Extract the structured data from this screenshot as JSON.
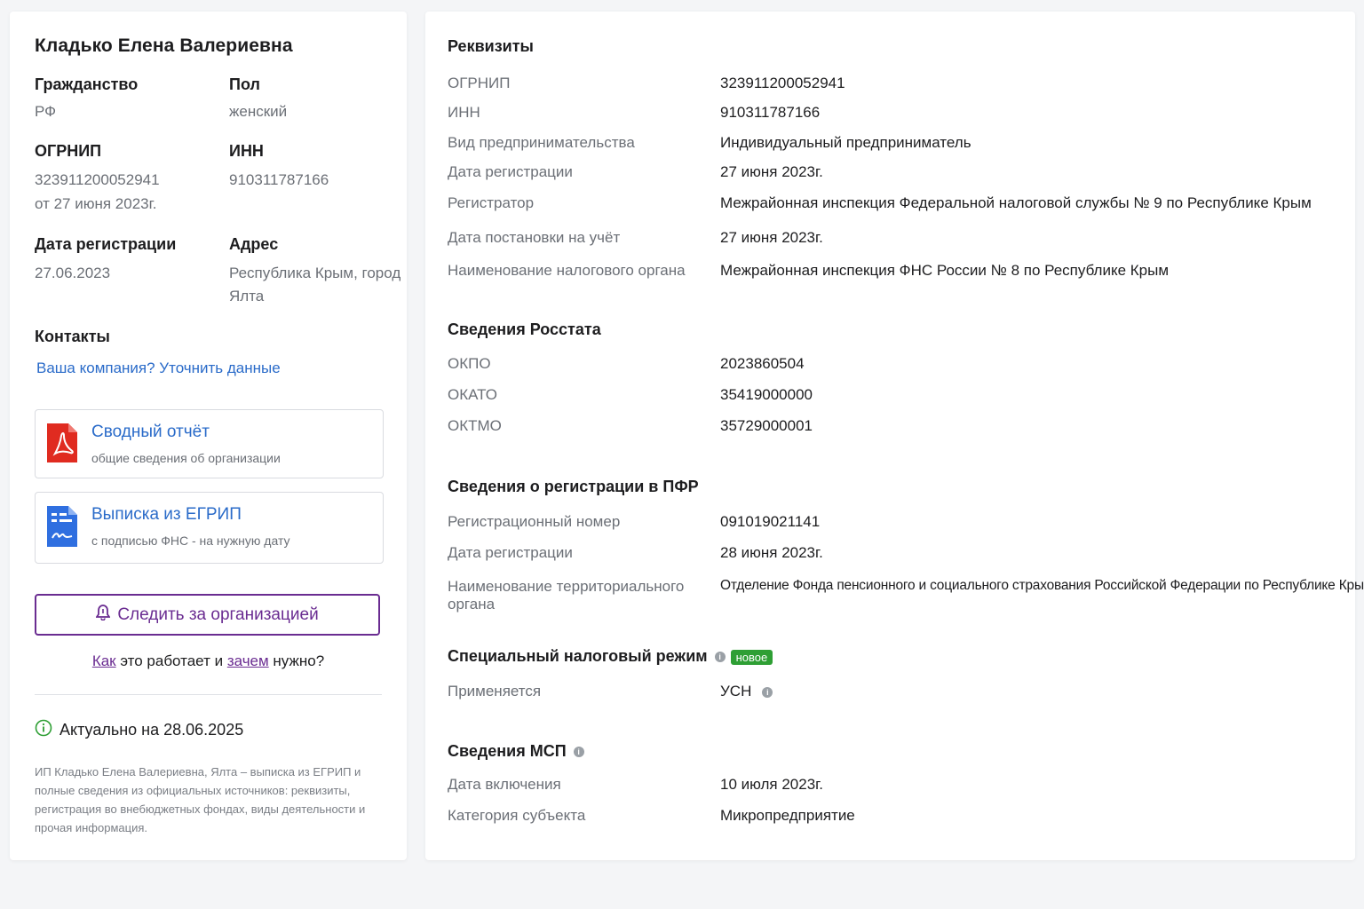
{
  "left": {
    "name": "Кладько Елена Валериевна",
    "citizenship": {
      "label": "Гражданство",
      "value": "РФ"
    },
    "gender": {
      "label": "Пол",
      "value": "женский"
    },
    "ogrnip": {
      "label": "ОГРНИП",
      "value": "323911200052941",
      "date": "от 27 июня 2023г."
    },
    "inn": {
      "label": "ИНН",
      "value": "910311787166"
    },
    "reg_date": {
      "label": "Дата регистрации",
      "value": "27.06.2023"
    },
    "address": {
      "label": "Адрес",
      "line1": "Республика Крым, город",
      "line2": "Ялта"
    },
    "contacts": {
      "label": "Контакты",
      "link": "Ваша компания? Уточнить данные"
    },
    "report": {
      "title": "Сводный отчёт",
      "subtitle": "общие сведения об организации"
    },
    "extract": {
      "title": "Выписка из ЕГРИП",
      "subtitle": "с подписью ФНС - на нужную дату"
    },
    "follow_button": "Следить за организацией",
    "how": {
      "how_link": "Как",
      "text1": " это работает и ",
      "why_link": "зачем",
      "text2": " нужно?"
    },
    "actual": "Актуально на 28.06.2025",
    "footnote": "ИП Кладько Елена Валериевна, Ялта – выписка из ЕГРИП и полные сведения из официальных источников: реквизиты, регистрация во внебюджетных фондах, виды деятельности и прочая информация."
  },
  "right": {
    "requisites": {
      "heading": "Реквизиты",
      "rows": [
        {
          "label": "ОГРНИП",
          "value": "323911200052941"
        },
        {
          "label": "ИНН",
          "value": "910311787166"
        },
        {
          "label": "Вид предпринимательства",
          "value": "Индивидуальный предприниматель"
        },
        {
          "label": "Дата регистрации",
          "value": "27 июня 2023г."
        },
        {
          "label": "Регистратор",
          "value": "Межрайонная инспекция Федеральной налоговой службы № 9 по Республике Крым"
        },
        {
          "label": "Дата постановки на учёт",
          "value": "27 июня 2023г."
        },
        {
          "label": "Наименование налогового органа",
          "value": "Межрайонная инспекция ФНС России № 8 по Республике Крым"
        }
      ]
    },
    "rosstat": {
      "heading": "Сведения Росстата",
      "rows": [
        {
          "label": "ОКПО",
          "value": "2023860504"
        },
        {
          "label": "ОКАТО",
          "value": "35419000000"
        },
        {
          "label": "ОКТМО",
          "value": "35729000001"
        }
      ]
    },
    "pfr": {
      "heading": "Сведения о регистрации в ПФР",
      "rows": [
        {
          "label": "Регистрационный номер",
          "value": "091019021141"
        },
        {
          "label": "Дата регистрации",
          "value": "28 июня 2023г."
        },
        {
          "label": "Наименование территориального органа",
          "value": "Отделение Фонда пенсионного и социального страхования  Российской Федерации  по Республике Крым"
        }
      ]
    },
    "tax_regime": {
      "heading": "Специальный налоговый режим",
      "badge": "новое",
      "label": "Применяется",
      "value": "УСН"
    },
    "msp": {
      "heading": "Сведения МСП",
      "rows": [
        {
          "label": "Дата включения",
          "value": "10 июля 2023г."
        },
        {
          "label": "Категория субъекта",
          "value": "Микропредприятие"
        }
      ]
    }
  },
  "colors": {
    "link": "#2a6bc9",
    "accent_purple": "#6a2c91",
    "badge_green": "#2e9f34",
    "pdf_red": "#e02b20",
    "doc_blue": "#2f6fe0"
  }
}
